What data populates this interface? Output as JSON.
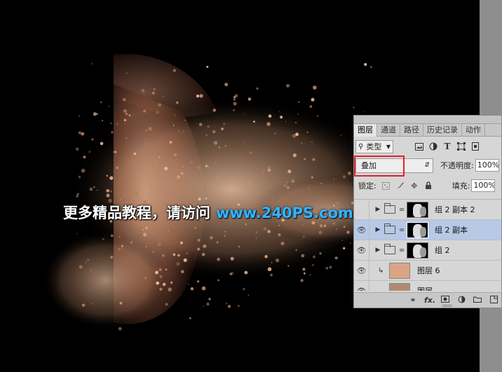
{
  "watermark": {
    "text_cn": "更多精品教程，请访问",
    "url": "www.240PS.com"
  },
  "colors": {
    "canvas_bg": "#000000",
    "dust": "#d9a684",
    "selected_layer": "#b7c9e6",
    "highlight_box": "#e0202c",
    "watermark_url": "#33b4ff"
  },
  "layers_panel": {
    "tabs": [
      "图层",
      "通道",
      "路径",
      "历史记录",
      "动作"
    ],
    "active_tab": "图层",
    "filter": {
      "kind_icon": "search-icon",
      "kind_label": "类型",
      "filter_icons": [
        "image-filter-icon",
        "adjustment-filter-icon",
        "type-filter-icon",
        "shape-filter-icon",
        "smart-object-filter-icon"
      ]
    },
    "blend_mode": "叠加",
    "opacity_label": "不透明度:",
    "opacity_value": "100%",
    "lock_label": "锁定:",
    "fill_label": "填充:",
    "fill_value": "100%",
    "layers": [
      {
        "name": "组 2 副本 2",
        "type": "group",
        "visible": false,
        "selected": false
      },
      {
        "name": "组 2 副本",
        "type": "group",
        "visible": true,
        "selected": true
      },
      {
        "name": "组 2",
        "type": "group",
        "visible": true,
        "selected": false
      },
      {
        "name": "图层 6",
        "type": "fill",
        "visible": true,
        "selected": false,
        "clipped": true
      },
      {
        "name": "图层 ...",
        "type": "image",
        "visible": true,
        "selected": false
      }
    ],
    "bottom_icons": [
      "link-layers-icon",
      "fx-icon",
      "add-mask-icon",
      "adjustment-layer-icon",
      "new-group-icon",
      "new-layer-icon",
      "delete-icon"
    ],
    "bottom_fx_label": "fx."
  }
}
